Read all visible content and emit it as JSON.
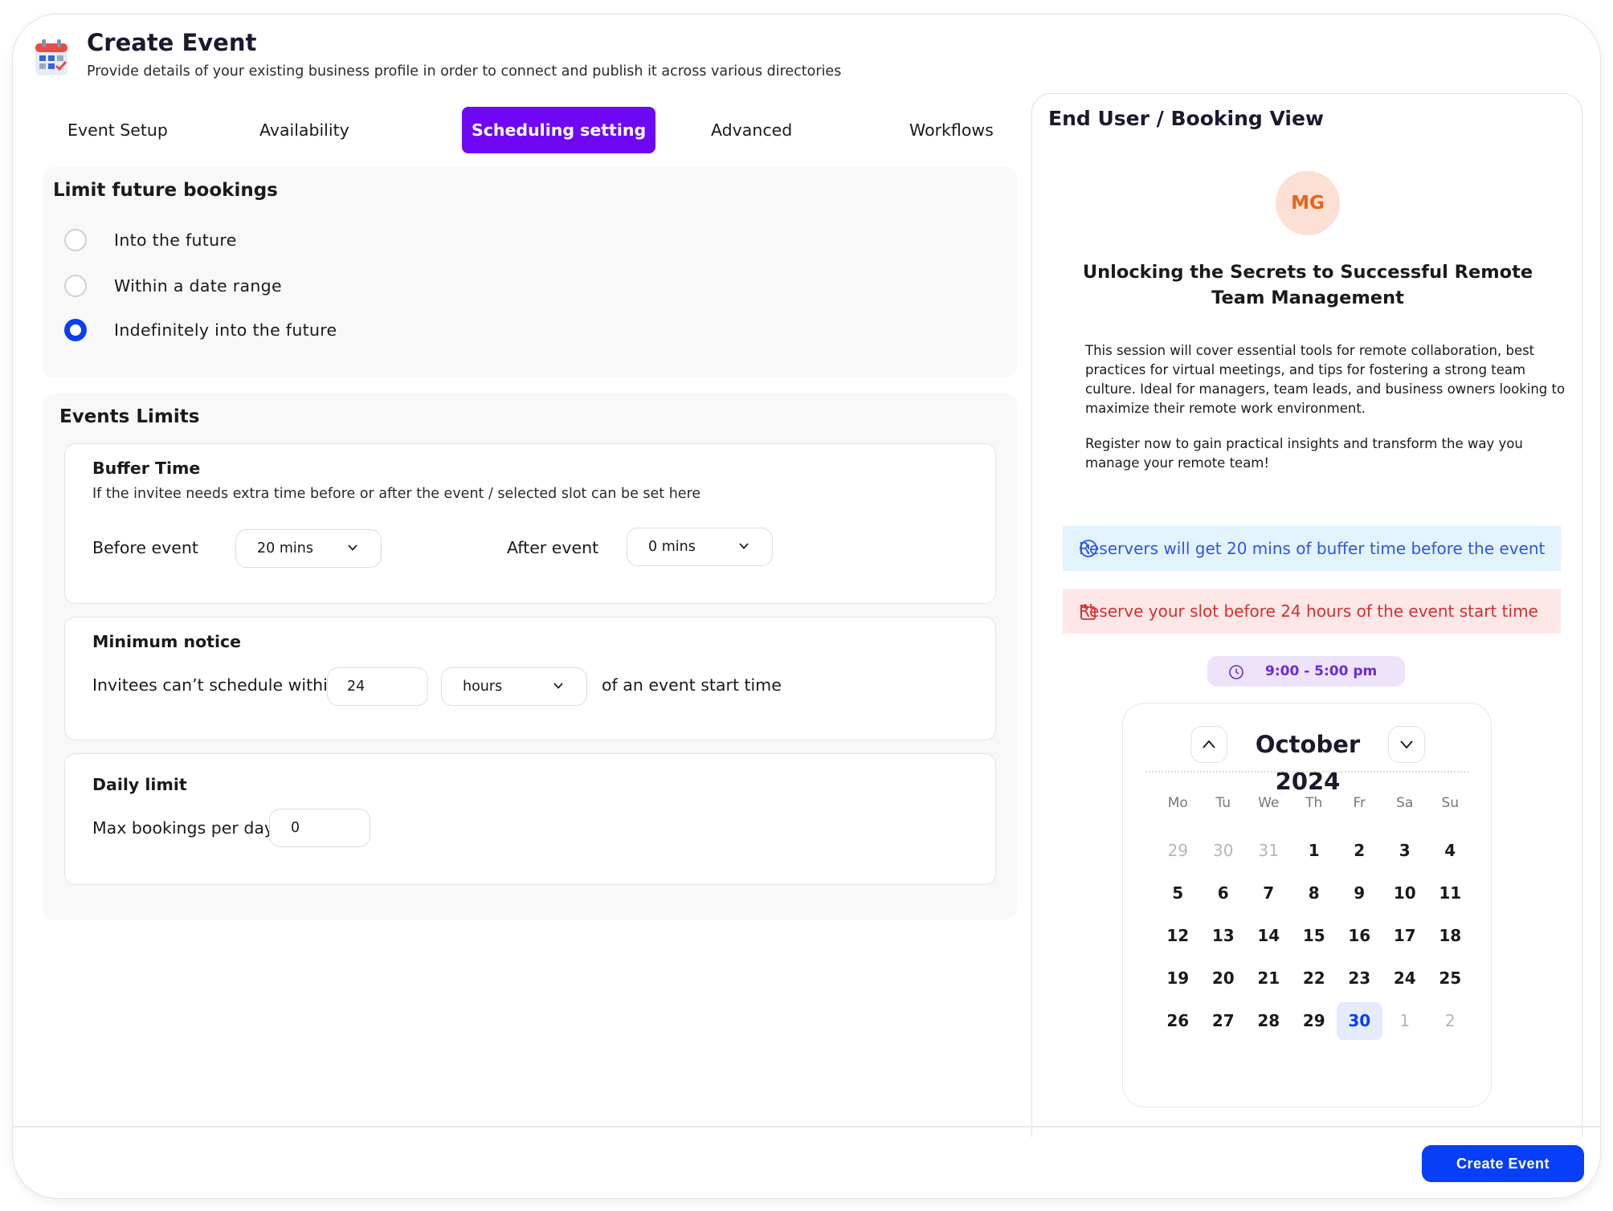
{
  "header": {
    "title": "Create Event",
    "subtitle": "Provide details of your existing business profile in order to connect and publish it across various directories"
  },
  "tabs": [
    {
      "label": "Event Setup",
      "active": false
    },
    {
      "label": "Availability",
      "active": false
    },
    {
      "label": "Scheduling setting",
      "active": true
    },
    {
      "label": "Advanced",
      "active": false
    },
    {
      "label": "Workflows",
      "active": false
    }
  ],
  "limit_future": {
    "title": "Limit future bookings",
    "options": [
      {
        "label": "Into the future",
        "checked": false
      },
      {
        "label": "Within a date range",
        "checked": false
      },
      {
        "label": "Indefinitely into the future",
        "checked": true
      }
    ]
  },
  "events_limits": {
    "title": "Events Limits",
    "buffer": {
      "title": "Buffer Time",
      "desc": "If the invitee needs extra time before or after the event / selected slot can be set here",
      "before_label": "Before event",
      "before_value": "20 mins",
      "after_label": "After event",
      "after_value": "0 mins"
    },
    "min_notice": {
      "title": "Minimum notice",
      "label": "Invitees can’t schedule within",
      "value": "24",
      "unit": "hours",
      "suffix": "of an event start time"
    },
    "daily": {
      "title": "Daily limit",
      "label": "Max bookings per day",
      "value": "0"
    }
  },
  "preview": {
    "title": "End User / Booking View",
    "avatar": "MG",
    "event_title": "Unlocking the Secrets to Successful Remote Team Management",
    "desc1": "This session will cover essential tools for remote collaboration, best practices for virtual meetings, and tips for fostering a strong team culture. Ideal for managers, team leads, and business owners looking to maximize their remote work environment.",
    "desc2": "Register now to gain practical insights and transform the way you manage your remote team!",
    "notice_buffer": "Reservers will get 20 mins of buffer time before the event",
    "notice_reserve": "Reserve your slot before 24 hours of the event start time",
    "time_range": "9:00 - 5:00 pm",
    "calendar": {
      "month": "October 2024",
      "weekdays": [
        "Mo",
        "Tu",
        "We",
        "Th",
        "Fr",
        "Sa",
        "Su"
      ],
      "days": [
        {
          "d": "29",
          "muted": true
        },
        {
          "d": "30",
          "muted": true
        },
        {
          "d": "31",
          "muted": true
        },
        {
          "d": "1"
        },
        {
          "d": "2"
        },
        {
          "d": "3"
        },
        {
          "d": "4"
        },
        {
          "d": "5"
        },
        {
          "d": "6"
        },
        {
          "d": "7"
        },
        {
          "d": "8"
        },
        {
          "d": "9"
        },
        {
          "d": "10"
        },
        {
          "d": "11"
        },
        {
          "d": "12"
        },
        {
          "d": "13"
        },
        {
          "d": "14"
        },
        {
          "d": "15"
        },
        {
          "d": "16"
        },
        {
          "d": "17"
        },
        {
          "d": "18"
        },
        {
          "d": "19"
        },
        {
          "d": "20"
        },
        {
          "d": "21"
        },
        {
          "d": "22"
        },
        {
          "d": "23"
        },
        {
          "d": "24"
        },
        {
          "d": "25"
        },
        {
          "d": "26"
        },
        {
          "d": "27"
        },
        {
          "d": "28"
        },
        {
          "d": "29"
        },
        {
          "d": "30",
          "selected": true
        },
        {
          "d": "1",
          "muted": true
        },
        {
          "d": "2",
          "muted": true
        }
      ]
    }
  },
  "footer": {
    "create_label": "Create Event"
  },
  "colors": {
    "accent_purple": "#6f07f5",
    "primary_blue": "#063ff5",
    "notice_blue_bg": "#e3f3fd",
    "notice_red_bg": "#fde7e7"
  }
}
